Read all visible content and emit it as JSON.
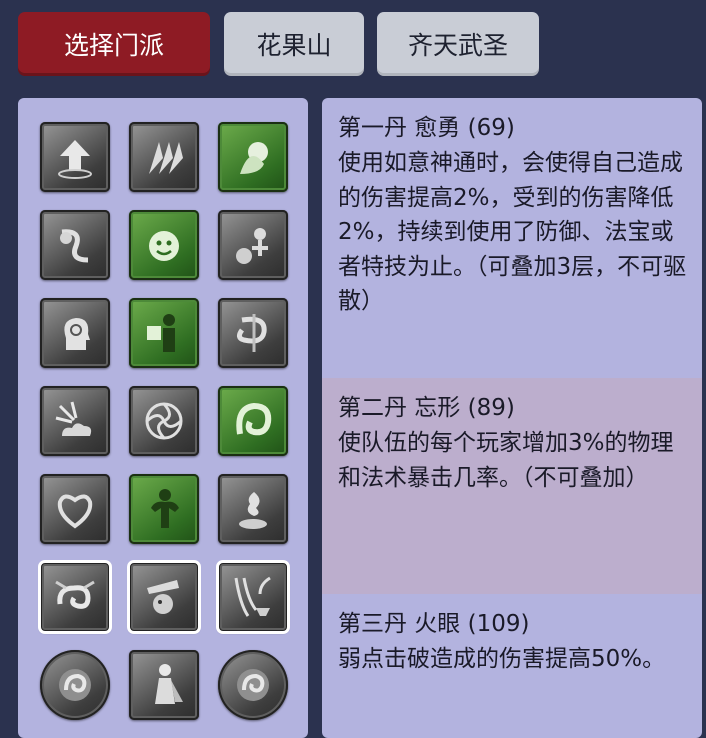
{
  "tabs": [
    {
      "label": "选择门派",
      "active": true
    },
    {
      "label": "花果山",
      "active": false
    },
    {
      "label": "齐天武圣",
      "active": false
    }
  ],
  "colors": {
    "active_tab": "#8e1b24",
    "inactive_tab": "#c9cdd6",
    "background": "#2b324f",
    "panel": "#b3b3df",
    "panel_alt_band": "#bcaecd",
    "icon_green": "#3f8a2c",
    "icon_gray": "#4a4a4a"
  },
  "skill_icons": [
    {
      "icon": "upward-arrow-icon",
      "style": "gray"
    },
    {
      "icon": "triple-arrows-icon",
      "style": "gray"
    },
    {
      "icon": "spirit-ghost-icon",
      "style": "green"
    },
    {
      "icon": "peach-swirl-icon",
      "style": "gray"
    },
    {
      "icon": "smiling-face-icon",
      "style": "green"
    },
    {
      "icon": "peach-figure-icon",
      "style": "gray"
    },
    {
      "icon": "mind-head-icon",
      "style": "gray"
    },
    {
      "icon": "figure-banner-icon",
      "style": "green"
    },
    {
      "icon": "spiral-symbol-icon",
      "style": "gray"
    },
    {
      "icon": "cloud-burst-icon",
      "style": "gray"
    },
    {
      "icon": "vortex-icon",
      "style": "gray"
    },
    {
      "icon": "green-swirl-icon",
      "style": "green"
    },
    {
      "icon": "heart-knot-icon",
      "style": "gray"
    },
    {
      "icon": "flexing-figure-icon",
      "style": "green"
    },
    {
      "icon": "hand-flame-icon",
      "style": "gray"
    },
    {
      "icon": "swirl-cloud-icon",
      "style": "gray",
      "selected": true
    },
    {
      "icon": "cannon-creature-icon",
      "style": "gray",
      "selected": true
    },
    {
      "icon": "curtain-cup-icon",
      "style": "gray",
      "selected": true
    },
    {
      "icon": "round-spiral-orb-icon",
      "style": "gray",
      "round": true
    },
    {
      "icon": "caped-figure-icon",
      "style": "gray"
    },
    {
      "icon": "round-spiral-orb-icon",
      "style": "gray",
      "round": true
    }
  ],
  "entries": [
    {
      "title": "第一丹 愈勇 (69)",
      "description": "使用如意神通时，会使得自己造成的伤害提高2%，受到的伤害降低2%，持续到使用了防御、法宝或者特技为止。（可叠加3层，不可驱散）"
    },
    {
      "title": "第二丹 忘形 (89)",
      "description": "使队伍的每个玩家增加3%的物理和法术暴击几率。（不可叠加）"
    },
    {
      "title": "第三丹 火眼 (109)",
      "description": "弱点击破造成的伤害提高50%。"
    }
  ]
}
